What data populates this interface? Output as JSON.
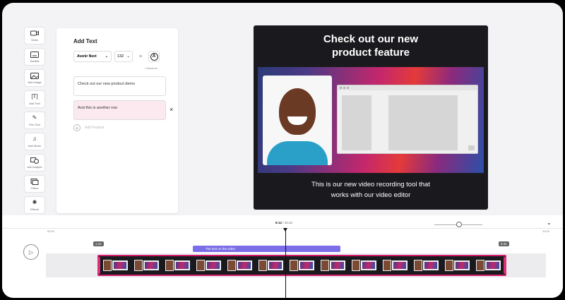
{
  "toolbar": {
    "items": [
      {
        "label": "Video",
        "icon": "video-camera-icon"
      },
      {
        "label": "Subtitle",
        "icon": "subtitle-icon"
      },
      {
        "label": "Add Image",
        "icon": "image-icon"
      },
      {
        "label": "Add Text",
        "icon": "text-icon"
      },
      {
        "label": "Pen Tool",
        "icon": "pen-icon"
      },
      {
        "label": "Add Music",
        "icon": "music-icon"
      },
      {
        "label": "Add shapes",
        "icon": "shapes-icon"
      },
      {
        "label": "Filters",
        "icon": "filters-icon"
      },
      {
        "label": "Effects",
        "icon": "effects-icon"
      }
    ]
  },
  "panel": {
    "title": "Add Text",
    "font": "Avenir Next",
    "font_size": "132",
    "style_letter": "A",
    "advance_label": "+ Advance",
    "rows": [
      "Check out our new product demo",
      "And this is another row"
    ],
    "remove_glyph": "×",
    "add_label": "Add Feature"
  },
  "preview": {
    "title_line1": "Check out our new",
    "title_line2": "product feature",
    "caption_line1": "This is our new video recording tool that",
    "caption_line2": "works with our video editor"
  },
  "timeline": {
    "current_time": "8:12",
    "total_time": "/ 10:12",
    "start_tick": "00:00",
    "end_tick": "10:00",
    "text_track_label": "The text on the video",
    "marker_start": "1.2s",
    "marker_end": "8.4s",
    "thumbnail_count": 13
  },
  "colors": {
    "accent_pink": "#d41c6c",
    "text_track": "#7b6ee8",
    "highlight_row": "#fce9ef"
  }
}
